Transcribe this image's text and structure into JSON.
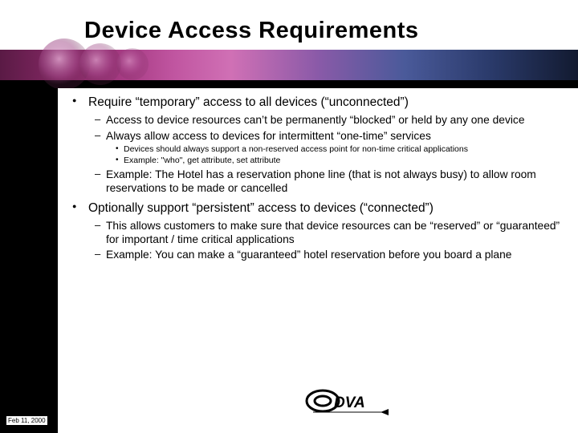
{
  "title": "Device Access Requirements",
  "footer_date": "Feb 11, 2000",
  "logo_text": "ODVA",
  "bullets": {
    "b1": "Require “temporary” access to all devices (“unconnected”)",
    "b1_1": "Access to device resources can’t be permanently “blocked” or held by any one device",
    "b1_2": "Always allow access to devices for intermittent “one-time” services",
    "b1_2_1": "Devices should always support a non-reserved access point for non-time critical applications",
    "b1_2_2": "Example: \"who\", get attribute, set attribute",
    "b1_3": "Example: The Hotel has a reservation phone line (that is not always busy) to allow room reservations to be made or cancelled",
    "b2": "Optionally support “persistent” access to devices (“connected”)",
    "b2_1": "This allows customers to make sure that device resources can be “reserved” or “guaranteed” for important / time critical applications",
    "b2_2": "Example: You can make a “guaranteed” hotel reservation before you board a plane"
  }
}
